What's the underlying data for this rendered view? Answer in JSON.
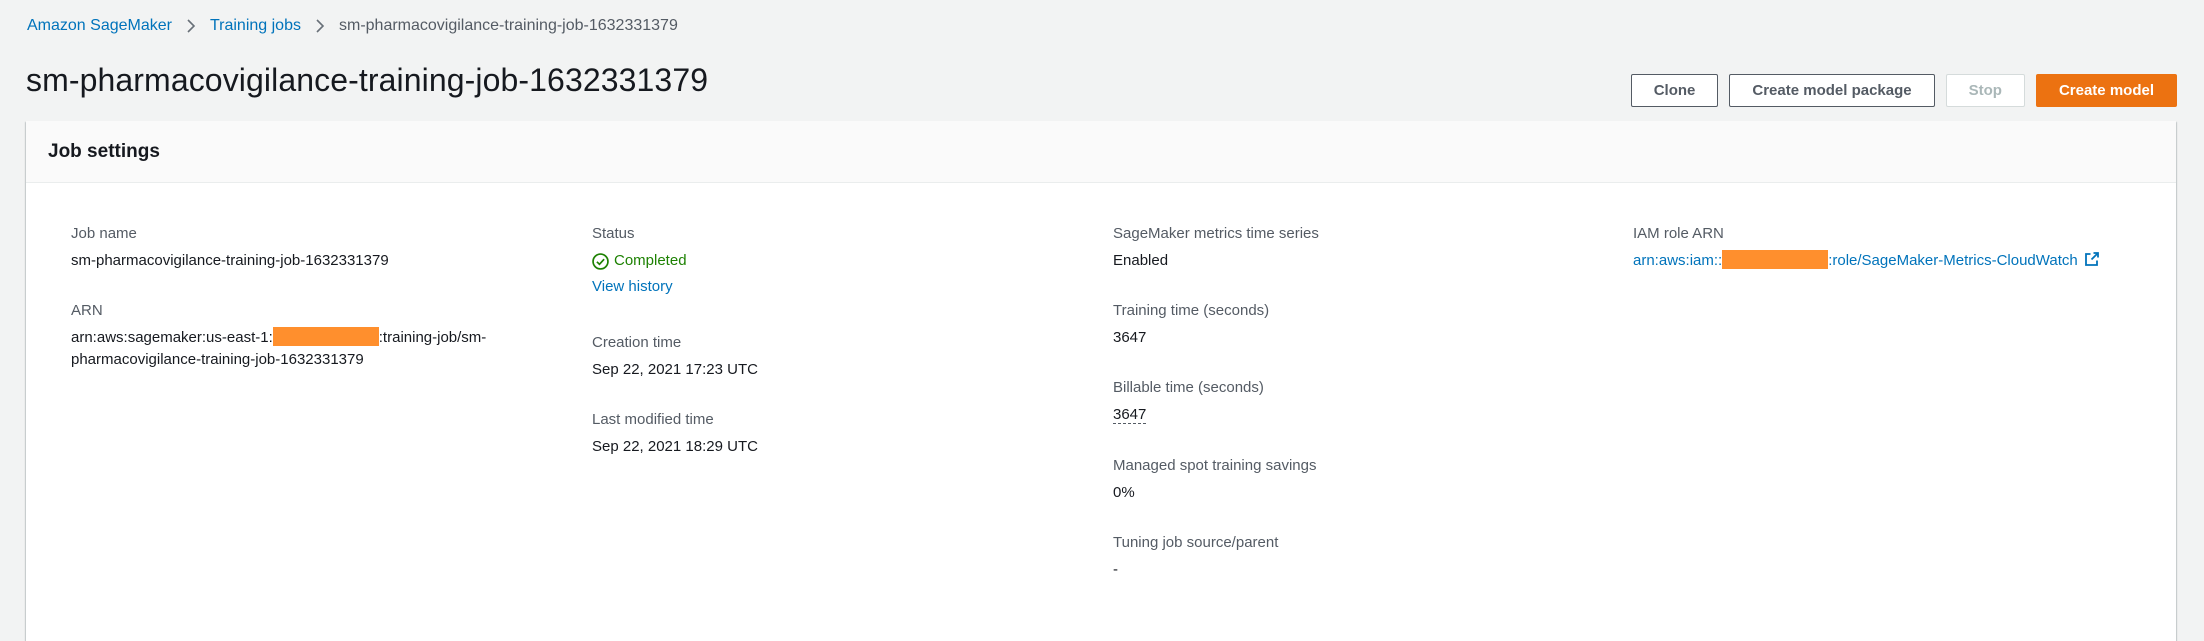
{
  "breadcrumb": {
    "items": [
      "Amazon SageMaker",
      "Training jobs"
    ],
    "current": "sm-pharmacovigilance-training-job-1632331379"
  },
  "page": {
    "title": "sm-pharmacovigilance-training-job-1632331379"
  },
  "actions": {
    "clone": "Clone",
    "create_model_package": "Create model package",
    "stop": "Stop",
    "create_model": "Create model"
  },
  "panel": {
    "title": "Job settings"
  },
  "fields": {
    "job_name": {
      "label": "Job name",
      "value": "sm-pharmacovigilance-training-job-1632331379"
    },
    "arn": {
      "label": "ARN",
      "value_prefix": "arn:aws:sagemaker:us-east-1:",
      "value_suffix": ":training-job/sm-pharmacovigilance-training-job-1632331379"
    },
    "status": {
      "label": "Status",
      "value": "Completed",
      "history_link": "View history"
    },
    "creation_time": {
      "label": "Creation time",
      "value": "Sep 22, 2021 17:23 UTC"
    },
    "last_modified_time": {
      "label": "Last modified time",
      "value": "Sep 22, 2021 18:29 UTC"
    },
    "metrics_time_series": {
      "label": "SageMaker metrics time series",
      "value": "Enabled"
    },
    "training_time": {
      "label": "Training time (seconds)",
      "value": "3647"
    },
    "billable_time": {
      "label": "Billable time (seconds)",
      "value": "3647"
    },
    "spot_savings": {
      "label": "Managed spot training savings",
      "value": "0%"
    },
    "tuning_job": {
      "label": "Tuning job source/parent",
      "value": "-"
    },
    "iam_role_arn": {
      "label": "IAM role ARN",
      "value_prefix": "arn:aws:iam::",
      "value_suffix": ":role/SageMaker-Metrics-CloudWatch"
    }
  },
  "colors": {
    "link": "#0073bb",
    "success": "#1d8102",
    "primary_button": "#ec7211",
    "redaction": "#ff8f2d"
  },
  "icons": [
    "chevron-right-icon",
    "status-success-icon",
    "external-link-icon"
  ]
}
